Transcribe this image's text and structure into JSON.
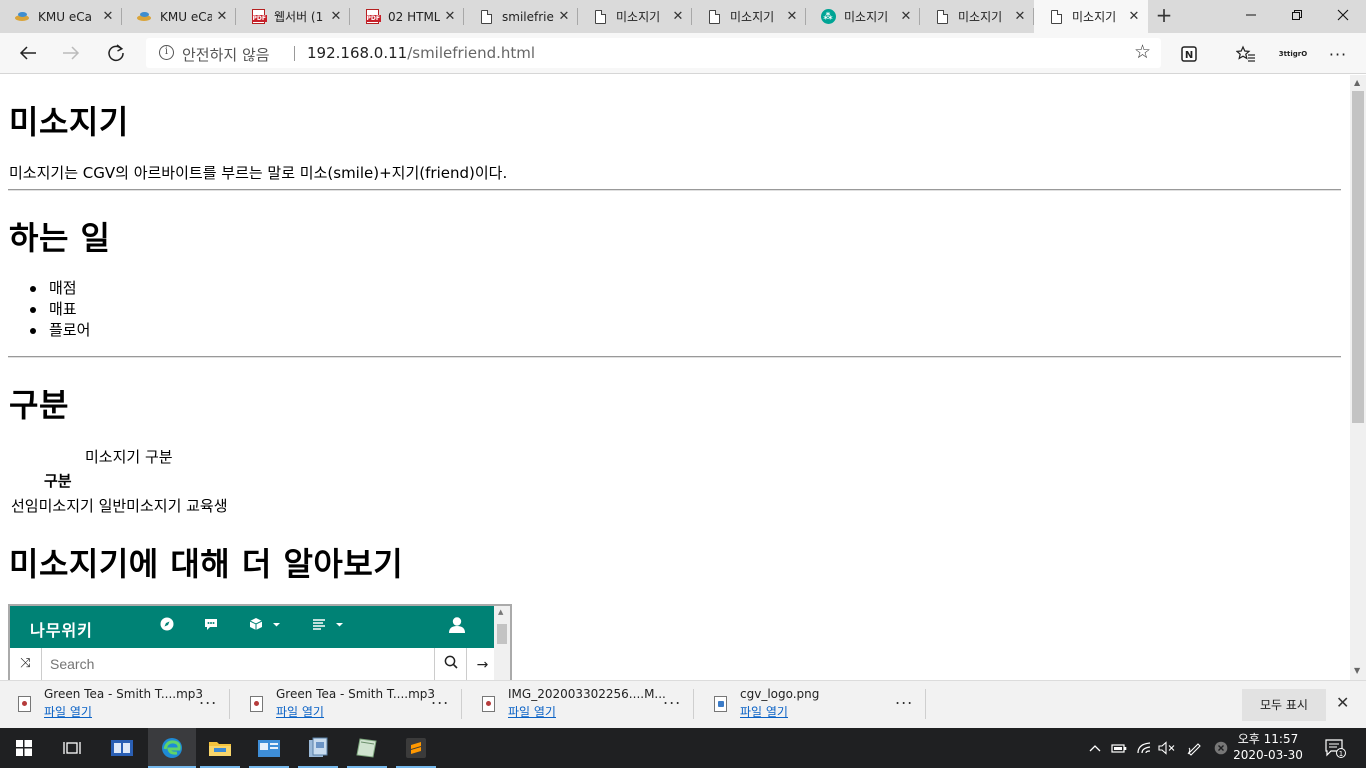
{
  "browser": {
    "tabs": [
      {
        "label": "KMU eCa",
        "icon": "kmu-icon",
        "active": false
      },
      {
        "label": "KMU eCa",
        "icon": "kmu-icon",
        "active": false
      },
      {
        "label": "웹서버 (1",
        "icon": "pdf-icon",
        "active": false
      },
      {
        "label": "02 HTML",
        "icon": "pdf-icon",
        "active": false
      },
      {
        "label": "smilefrie",
        "icon": "page-icon",
        "active": false
      },
      {
        "label": "미소지기",
        "icon": "page-icon",
        "active": false
      },
      {
        "label": "미소지기",
        "icon": "page-icon",
        "active": false
      },
      {
        "label": "미소지기",
        "icon": "namuwiki-icon",
        "active": false
      },
      {
        "label": "미소지기",
        "icon": "page-icon",
        "active": false
      },
      {
        "label": "미소지기",
        "icon": "page-icon",
        "active": true
      }
    ],
    "address": {
      "security_label": "안전하지 않음",
      "host": "192.168.0.11",
      "path": "/smilefriend.html"
    },
    "profile_label": "3ttigrO"
  },
  "page": {
    "h_title": "미소지기",
    "intro": "미소지기는 CGV의 아르바이트를 부르는 말로 미소(smile)+지기(friend)이다.",
    "h_work": "하는 일",
    "work_items": [
      "매점",
      "매표",
      "플로어"
    ],
    "h_division": "구분",
    "table_caption": "미소지기 구분",
    "table_header": "구분",
    "table_row": "선임미소지기 일반미소지기 교육생",
    "h_more": "미소지기에 대해 더 알아보기",
    "embed": {
      "logo": "나무위키",
      "search_placeholder": "Search"
    }
  },
  "downloads": {
    "items": [
      {
        "name": "Green Tea - Smith T....mp3",
        "action": "파일 열기",
        "icon": "audio-file-icon"
      },
      {
        "name": "Green Tea - Smith T....mp3",
        "action": "파일 열기",
        "icon": "audio-file-icon"
      },
      {
        "name": "IMG_202003302256....M...",
        "action": "파일 열기",
        "icon": "video-file-icon"
      },
      {
        "name": "cgv_logo.png",
        "action": "파일 열기",
        "icon": "image-file-icon"
      }
    ],
    "more_label": "...",
    "show_all": "모두 표시"
  },
  "taskbar": {
    "clock_time": "오후 11:57",
    "clock_date": "2020-03-30",
    "notification_count": "1"
  }
}
